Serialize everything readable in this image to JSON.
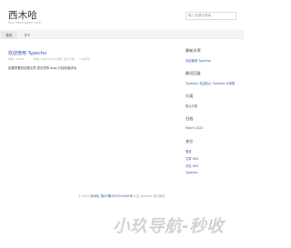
{
  "header": {
    "site_title": "西木哈",
    "site_description": "Your description here.",
    "search_placeholder": "输入关键字搜索"
  },
  "nav": {
    "items": [
      {
        "label": "首页"
      },
      {
        "label": "关于"
      }
    ]
  },
  "post": {
    "title": "欢迎使用 Typecho",
    "author": "作者: 15A2B",
    "date": "时间: 2023-03-31",
    "category": "分类: 默认分类",
    "comments": "1 条评论",
    "body": "如果您看到这篇文章,表示您的 blog 已经安装成功."
  },
  "sidebar": {
    "recent_posts_title": "最新文章",
    "recent_posts": [
      "欢迎使用 Typecho"
    ],
    "recent_comments_title": "最近回复",
    "recent_comments": [
      "Typecho: 欢迎加入 Typecho 大家族"
    ],
    "categories_title": "分类",
    "categories": [
      "默认分类"
    ],
    "archives_title": "归档",
    "archives": [
      "March 2023"
    ],
    "other_title": "其它",
    "other_links": [
      "登录",
      "文章 RSS",
      "评论 RSS",
      "Typecho"
    ]
  },
  "footer": {
    "copyright": "© 2023",
    "site_link": "西木哈",
    "beian_prefix": ".",
    "beian": "豫ICP备2023010961号-1",
    "powered": "由 Typecho 强力驱动."
  },
  "watermark": {
    "text": "小玖导航-秒收"
  }
}
